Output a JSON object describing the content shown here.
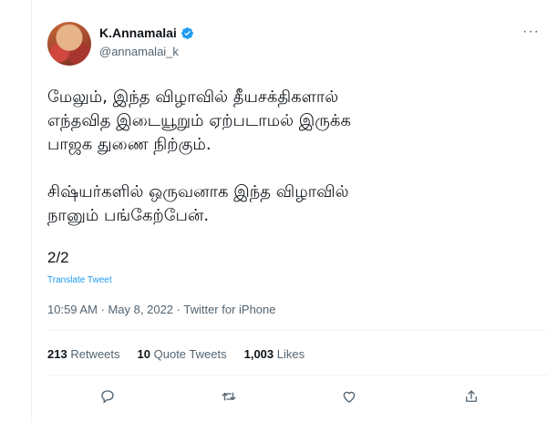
{
  "author": {
    "display_name": "K.Annamalai",
    "handle": "@annamalai_k",
    "verified_icon": "verified-badge-icon",
    "avatar": "profile-photo"
  },
  "tweet": {
    "text": "மேலும், இந்த விழாவில் தீயசக்திகளால்\nஎந்தவித இடையூறும் ஏற்படாமல் இருக்க\nபாஜக துணை நிற்கும்.\n\nசிஷ்யர்களில் ஒருவனாக இந்த விழாவில்\nநானும் பங்கேற்பேன்.",
    "counter": "2/2",
    "translate_label": "Translate Tweet",
    "timestamp": "10:59 AM · May 8, 2022 · Twitter for iPhone"
  },
  "stats": {
    "retweets_count": "213",
    "retweets_label": "Retweets",
    "quotes_count": "10",
    "quotes_label": "Quote Tweets",
    "likes_count": "1,003",
    "likes_label": "Likes"
  },
  "icons": {
    "more": "more-options-icon",
    "reply": "reply-icon",
    "retweet": "retweet-icon",
    "like": "like-icon",
    "share": "share-icon"
  },
  "colors": {
    "accent": "#1d9bf0",
    "muted_text": "#536471",
    "text": "#0f1419",
    "divider": "#eff3f4"
  }
}
